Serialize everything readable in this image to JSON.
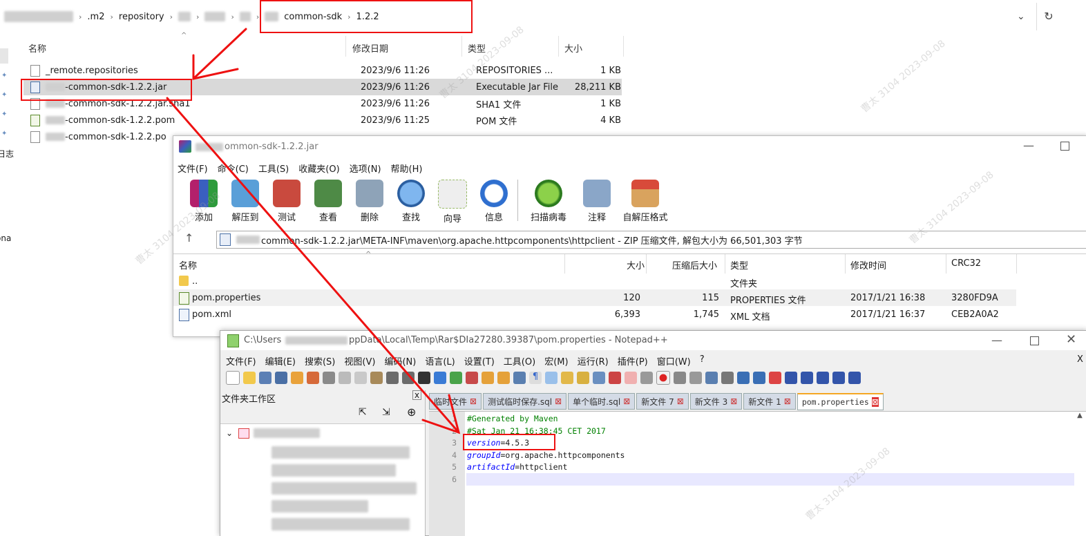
{
  "explorer": {
    "breadcrumb": [
      ".m2",
      "repository",
      "common-sdk",
      "1.2.2"
    ],
    "columns": {
      "name": "名称",
      "modified": "修改日期",
      "type": "类型",
      "size": "大小"
    },
    "rows": [
      {
        "name": "_remote.repositories",
        "date": "2023/9/6 11:26",
        "type": "REPOSITORIES ...",
        "size": "1 KB"
      },
      {
        "name": "-common-sdk-1.2.2.jar",
        "date": "2023/9/6 11:26",
        "type": "Executable Jar File",
        "size": "28,211 KB"
      },
      {
        "name": "-common-sdk-1.2.2.jar.sha1",
        "date": "2023/9/6 11:26",
        "type": "SHA1 文件",
        "size": "1 KB"
      },
      {
        "name": "-common-sdk-1.2.2.pom",
        "date": "2023/9/6 11:25",
        "type": "POM 文件",
        "size": "4 KB"
      },
      {
        "name": "-common-sdk-1.2.2.po",
        "date": "",
        "type": "",
        "size": ""
      }
    ],
    "left_labels": [
      "日志",
      "ona"
    ]
  },
  "winrar": {
    "title": "ommon-sdk-1.2.2.jar",
    "menu": [
      "文件(F)",
      "命令(C)",
      "工具(S)",
      "收藏夹(O)",
      "选项(N)",
      "帮助(H)"
    ],
    "tools": [
      "添加",
      "解压到",
      "测试",
      "查看",
      "删除",
      "查找",
      "向导",
      "信息",
      "扫描病毒",
      "注释",
      "自解压格式"
    ],
    "path": "common-sdk-1.2.2.jar\\META-INF\\maven\\org.apache.httpcomponents\\httpclient - ZIP 压缩文件, 解包大小为 66,501,303 字节",
    "columns": {
      "name": "名称",
      "size": "大小",
      "packed": "压缩后大小",
      "type": "类型",
      "modified": "修改时间",
      "crc": "CRC32"
    },
    "rows": [
      {
        "name": "..",
        "size": "",
        "packed": "",
        "type": "文件夹",
        "modified": "",
        "crc": ""
      },
      {
        "name": "pom.properties",
        "size": "120",
        "packed": "115",
        "type": "PROPERTIES 文件",
        "modified": "2017/1/21 16:38",
        "crc": "3280FD9A"
      },
      {
        "name": "pom.xml",
        "size": "6,393",
        "packed": "1,745",
        "type": "XML 文档",
        "modified": "2017/1/21 16:37",
        "crc": "CEB2A0A2"
      }
    ]
  },
  "npp": {
    "title_prefix": "C:\\Users",
    "title_suffix": "ppData\\Local\\Temp\\Rar$DIa27280.39387\\pom.properties - Notepad++",
    "menu": [
      "文件(F)",
      "编辑(E)",
      "搜索(S)",
      "视图(V)",
      "编码(N)",
      "语言(L)",
      "设置(T)",
      "工具(O)",
      "宏(M)",
      "运行(R)",
      "插件(P)",
      "窗口(W)",
      "?"
    ],
    "close_x": "X",
    "panel_title": "文件夹工作区",
    "tabs": [
      "临时文件",
      "测试临时保存.sql",
      "单个临时.sql",
      "新文件 7",
      "新文件 3",
      "新文件 1",
      "pom.properties"
    ],
    "lines": [
      {
        "num": "1",
        "text": "#Generated by Maven"
      },
      {
        "num": "2",
        "text": "#Sat Jan 21 16:38:45 CET 2017"
      },
      {
        "num": "3",
        "key": "version",
        "value": "=4.5.3"
      },
      {
        "num": "4",
        "key": "groupId",
        "value": "=org.apache.httpcomponents"
      },
      {
        "num": "5",
        "key": "artifactId",
        "value": "=httpclient"
      },
      {
        "num": "6",
        "text": ""
      }
    ]
  },
  "watermark": "曹太 3104 2023-09-08",
  "colors": {
    "highlight_red": "#e11111",
    "selected_row": "#d9d9d9",
    "comment_green": "#008000",
    "key_blue": "#0000ff"
  }
}
